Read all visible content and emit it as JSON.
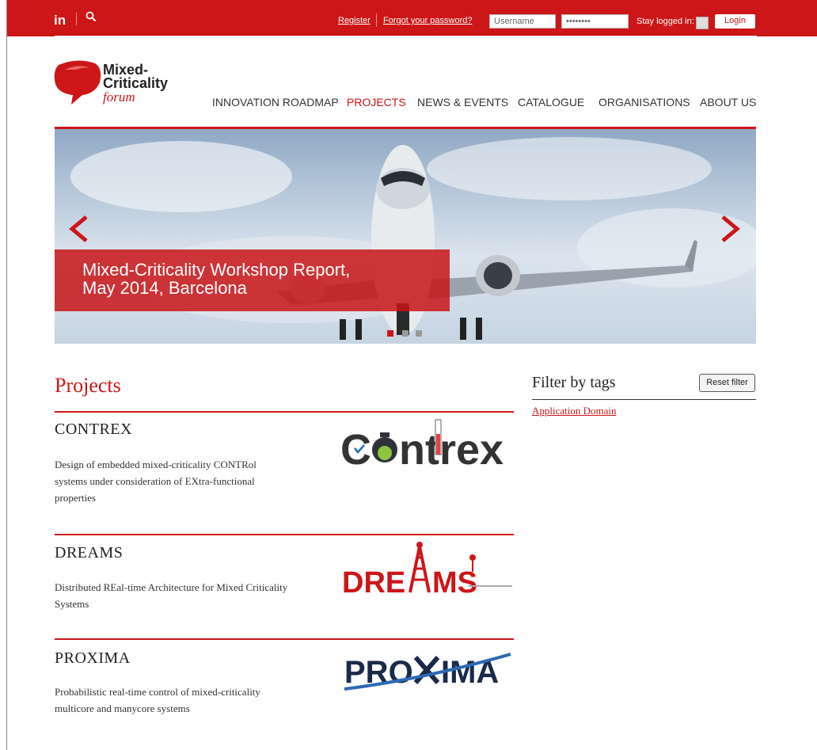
{
  "topbar": {
    "linkedin_label": "in",
    "register_label": "Register",
    "forgot_label": "Forgot your password?",
    "username_placeholder": "Username",
    "password_value": "••••••••",
    "stay_logged_label": "Stay logged in:",
    "login_label": "Login",
    "accent_color": "#cc1618"
  },
  "logo": {
    "line1": "Mixed-",
    "line2": "Criticality",
    "line3": "forum"
  },
  "nav": {
    "items": [
      {
        "label": "INNOVATION ROADMAP"
      },
      {
        "label": "PROJECTS",
        "active": true
      },
      {
        "label": "NEWS & EVENTS"
      },
      {
        "label": "CATALOGUE"
      },
      {
        "label": "ORGANISATIONS"
      },
      {
        "label": "ABOUT US"
      }
    ]
  },
  "hero": {
    "caption_line1": "Mixed-Criticality Workshop Report,",
    "caption_line2": "May 2014, Barcelona",
    "prev_icon": "chevron-left-icon",
    "next_icon": "chevron-right-icon",
    "slide_count": 3,
    "active_slide": 1
  },
  "main": {
    "title": "Projects",
    "projects": [
      {
        "title": "CONTREX",
        "desc_lines": [
          "Design of embedded mixed-criticality CONTRol",
          "systems under consideration of EXtra-functional",
          "properties"
        ],
        "logo_text": "Contrex"
      },
      {
        "title": "DREAMS",
        "desc_lines": [
          "Distributed REal-time Architecture for Mixed Criticality",
          "Systems"
        ],
        "logo_text": "DREAMS"
      },
      {
        "title": "PROXIMA",
        "desc_lines": [
          "Probabilistic real-time control of mixed-criticality",
          "multicore and manycore systems"
        ],
        "logo_text": "PROXIMA"
      }
    ]
  },
  "sidebar": {
    "title": "Filter by tags",
    "reset_label": "Reset filter",
    "tags": [
      "Application Domain"
    ]
  }
}
